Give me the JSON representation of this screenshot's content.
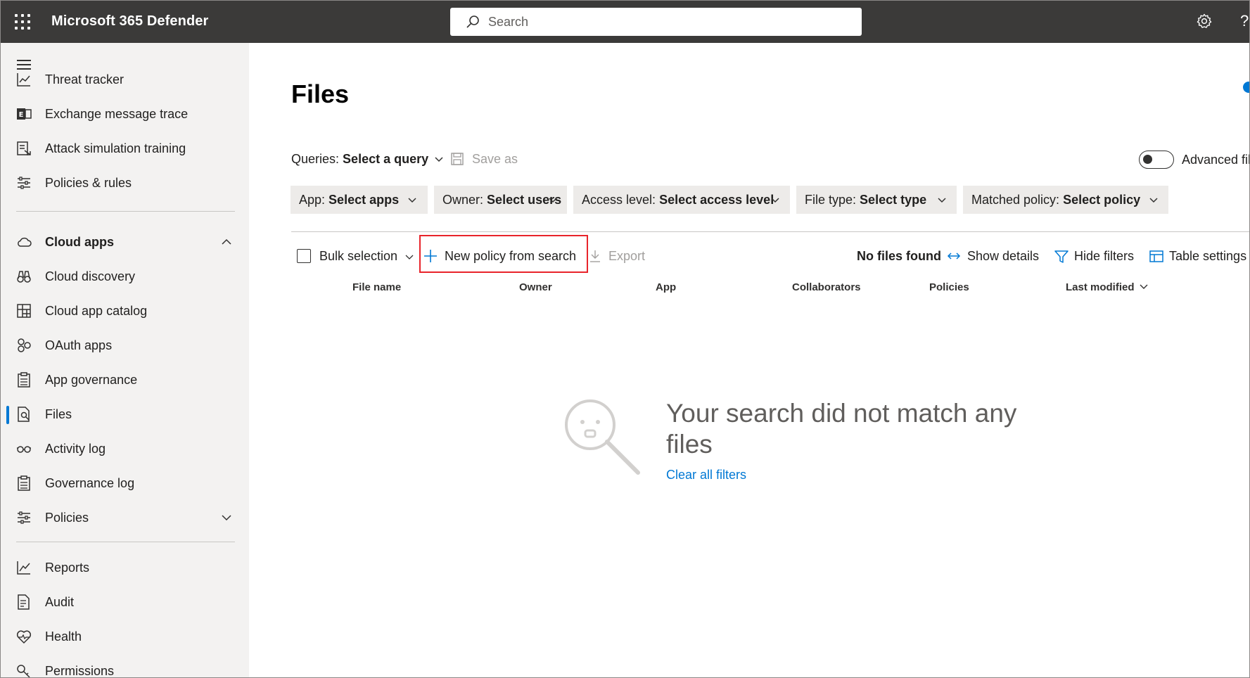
{
  "topbar": {
    "app_title": "Microsoft 365 Defender",
    "search_placeholder": "Search",
    "help_glyph": "?"
  },
  "sidebar": {
    "items": [
      {
        "label": "Threat tracker",
        "icon": "chart-icon"
      },
      {
        "label": "Exchange message trace",
        "icon": "exchange-icon"
      },
      {
        "label": "Attack simulation training",
        "icon": "simulation-icon"
      },
      {
        "label": "Policies & rules",
        "icon": "sliders-icon"
      },
      {
        "label": "Cloud apps",
        "icon": "cloud-icon"
      },
      {
        "label": "Cloud discovery",
        "icon": "binoculars-icon"
      },
      {
        "label": "Cloud app catalog",
        "icon": "catalog-icon"
      },
      {
        "label": "OAuth apps",
        "icon": "oauth-icon"
      },
      {
        "label": "App governance",
        "icon": "clipboard-icon"
      },
      {
        "label": "Files",
        "icon": "files-icon"
      },
      {
        "label": "Activity log",
        "icon": "glasses-icon"
      },
      {
        "label": "Governance log",
        "icon": "clipboard-icon"
      },
      {
        "label": "Policies",
        "icon": "sliders-icon"
      },
      {
        "label": "Reports",
        "icon": "line-chart-icon"
      },
      {
        "label": "Audit",
        "icon": "audit-icon"
      },
      {
        "label": "Health",
        "icon": "heart-pulse-icon"
      },
      {
        "label": "Permissions",
        "icon": "key-icon"
      }
    ],
    "active_item": "Files"
  },
  "main": {
    "title": "Files",
    "queries_label": "Queries:",
    "queries_value": "Select a query",
    "save_as": "Save as",
    "advanced_filters": "Advanced filters",
    "advanced_filters_on": false,
    "filters": [
      {
        "label": "App:",
        "value": "Select apps"
      },
      {
        "label": "Owner:",
        "value": "Select users"
      },
      {
        "label": "Access level:",
        "value": "Select access level"
      },
      {
        "label": "File type:",
        "value": "Select type"
      },
      {
        "label": "Matched policy:",
        "value": "Select policy"
      }
    ],
    "toolbar": {
      "bulk_selection": "Bulk selection",
      "new_policy": "New policy from search",
      "export": "Export",
      "status": "No files found",
      "show_details": "Show details",
      "hide_filters": "Hide filters",
      "table_settings": "Table settings"
    },
    "columns": [
      "File name",
      "Owner",
      "App",
      "Collaborators",
      "Policies",
      "Last modified"
    ],
    "empty_state": {
      "message": "Your search did not match any files",
      "clear_link": "Clear all filters"
    }
  },
  "colors": {
    "topbar": "#3b3a39",
    "accent": "#0078d4",
    "highlight": "#e8242b",
    "sidebar": "#f3f2f1"
  }
}
